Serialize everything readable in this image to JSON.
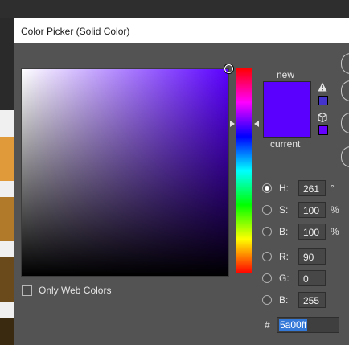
{
  "dialog": {
    "title": "Color Picker (Solid Color)"
  },
  "preview": {
    "new_label": "new",
    "current_label": "current",
    "new_color": "#5a00ff",
    "current_color": "#5a00ff"
  },
  "web_colors": {
    "label": "Only Web Colors",
    "checked": false
  },
  "fields": {
    "H": {
      "label": "H:",
      "value": "261",
      "unit": "°",
      "selected": true
    },
    "S": {
      "label": "S:",
      "value": "100",
      "unit": "%",
      "selected": false
    },
    "Bv": {
      "label": "B:",
      "value": "100",
      "unit": "%",
      "selected": false
    },
    "R": {
      "label": "R:",
      "value": "90",
      "unit": "",
      "selected": false
    },
    "G": {
      "label": "G:",
      "value": "0",
      "unit": "",
      "selected": false
    },
    "Bl": {
      "label": "B:",
      "value": "255",
      "unit": "",
      "selected": false
    }
  },
  "hex": {
    "hash": "#",
    "value": "5a00ff"
  },
  "colors": {
    "warn_swatch": "#4433cc",
    "websafe_swatch": "#6600ff"
  },
  "icons": {
    "gamut_warning": "warning-triangle-icon",
    "web_safe": "cube-icon"
  }
}
